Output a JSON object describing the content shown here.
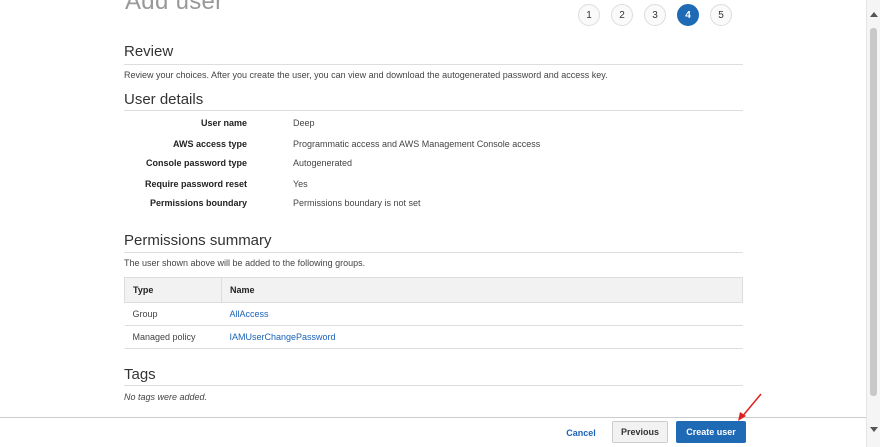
{
  "header": {
    "title": "Add user",
    "steps": [
      "1",
      "2",
      "3",
      "4",
      "5"
    ],
    "active_step": "4"
  },
  "review": {
    "title": "Review",
    "description": "Review your choices. After you create the user, you can view and download the autogenerated password and access key."
  },
  "user_details": {
    "title": "User details",
    "rows": [
      {
        "label": "User name",
        "value": "Deep"
      },
      {
        "label": "AWS access type",
        "value": "Programmatic access and AWS Management Console access"
      },
      {
        "label": "Console password type",
        "value": "Autogenerated"
      },
      {
        "label": "Require password reset",
        "value": "Yes"
      },
      {
        "label": "Permissions boundary",
        "value": "Permissions boundary is not set"
      }
    ]
  },
  "permissions": {
    "title": "Permissions summary",
    "description": "The user shown above will be added to the following groups.",
    "columns": [
      "Type",
      "Name"
    ],
    "rows": [
      {
        "type": "Group",
        "name": "AllAccess"
      },
      {
        "type": "Managed policy",
        "name": "IAMUserChangePassword"
      }
    ]
  },
  "tags": {
    "title": "Tags",
    "empty_text": "No tags were added."
  },
  "footer": {
    "cancel_label": "Cancel",
    "previous_label": "Previous",
    "create_label": "Create user"
  },
  "colors": {
    "primary": "#1f6ab5",
    "link": "#1a63b8",
    "annotation_arrow": "#e02020"
  }
}
